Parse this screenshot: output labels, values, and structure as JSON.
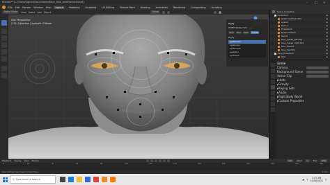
{
  "window": {
    "title": "Blender* [C:\\Users\\Agrav\\Documents\\face_face_wireframe.blend]",
    "controls": [
      "–",
      "□",
      "✕"
    ]
  },
  "menubar": {
    "items": [
      "File",
      "Edit",
      "Render",
      "Window",
      "Help"
    ],
    "workspaces": [
      "Layout",
      "Modeling",
      "Sculpting",
      "UV Editing",
      "Texture Paint",
      "Shading",
      "Animation",
      "Rendering",
      "Compositing",
      "Scripting"
    ],
    "active_workspace": "Layout"
  },
  "viewport_header": {
    "mode": "Object Mode",
    "items": [
      "View",
      "Select",
      "Add",
      "Object"
    ],
    "transform": "Global"
  },
  "viewport": {
    "view_label": "User Perspective",
    "collection_label": "(124) Collection | eyeballs-LOWskel"
  },
  "npanel": {
    "section": "Rigify",
    "subtitle": "RMPIE Wlabe Hint",
    "tabs": [
      "Item",
      "Tool",
      "View",
      "Create"
    ],
    "active_tab": "Create",
    "list_title": "Rigify",
    "items": [
      "eyebrows.l",
      "eyebrow.L",
      "eyebrow.R",
      "eyelids.L",
      "eyelids.R"
    ],
    "selected_item": "eyebrows.l"
  },
  "outliner": {
    "header": [
      "Scene Collection"
    ],
    "rows": [
      {
        "label": "Collection",
        "color": "#ddd"
      },
      {
        "label": "eyebrowsMesh.001",
        "color": "#e98c2e"
      },
      {
        "label": "eyeLid",
        "color": "#e98c2e"
      },
      {
        "label": "Eyes.L",
        "color": "#e98c2e"
      },
      {
        "label": "Eyeballs.R",
        "color": "#e98c2e"
      },
      {
        "label": "EyebrowMesh",
        "color": "#e98c2e"
      },
      {
        "label": "face.R",
        "color": "#e98c2e"
      },
      {
        "label": "face_marks_left.002",
        "color": "#e98c2e"
      },
      {
        "label": "face_marks_right.001",
        "color": "#e98c2e"
      },
      {
        "label": "face_head.R",
        "color": "#e98c2e"
      },
      {
        "label": "face_hair.001",
        "color": "#e98c2e"
      },
      {
        "label": "Face_Collection",
        "color": "#ddd"
      },
      {
        "label": "Hair",
        "color": "#e98c2e"
      }
    ]
  },
  "properties": {
    "section": "Scene",
    "rows": [
      {
        "label": "Camera",
        "field": true
      },
      {
        "label": "Background Scene",
        "field": true
      },
      {
        "label": "Active Clip",
        "field": true
      },
      {
        "label": "Units",
        "field": false
      },
      {
        "label": "Gravity",
        "field": false
      },
      {
        "label": "Keying Sets",
        "field": false
      },
      {
        "label": "Audio",
        "field": false
      },
      {
        "label": "Rigid Body World",
        "field": false
      },
      {
        "label": "Custom Properties",
        "field": false
      }
    ]
  },
  "timeline": {
    "menus": [
      "Playback",
      "Keying",
      "View",
      "Marker"
    ],
    "start_label": "Start",
    "start": "1",
    "end_label": "End",
    "end": "250",
    "current_frame": "124",
    "ruler": [
      "0",
      "20",
      "40",
      "60",
      "80",
      "100",
      "120",
      "140",
      "160",
      "180",
      "200",
      "220",
      "240",
      "250"
    ]
  },
  "statusbar": {
    "left": "Select   Rotate View   Object Context Menu",
    "version": "2.93.1"
  },
  "taskbar": {
    "search_placeholder": "Type here to search",
    "icons": [
      {
        "name": "task-view-icon",
        "color": "#444"
      },
      {
        "name": "edge-icon",
        "color": "#1e7fd6"
      },
      {
        "name": "file-explorer-icon",
        "color": "#f0c030"
      },
      {
        "name": "store-icon",
        "color": "#2b6cd6"
      },
      {
        "name": "chrome-icon",
        "color": "#db4437"
      },
      {
        "name": "blender-icon",
        "color": "#f08a24"
      },
      {
        "name": "firefox-icon",
        "color": "#ff7a00"
      }
    ],
    "time": "2:07 AM",
    "date": "10/16/2021"
  }
}
